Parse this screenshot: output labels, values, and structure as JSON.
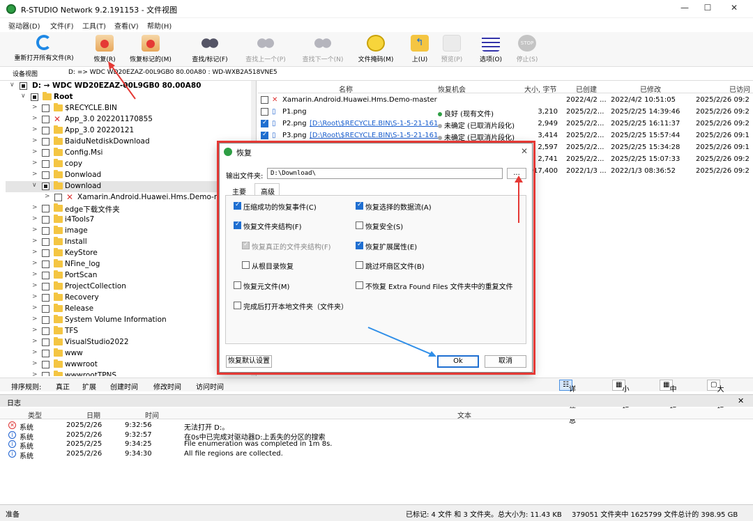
{
  "window": {
    "title": "R-STUDIO Network 9.2.191153 - 文件视图"
  },
  "menu": [
    "驱动器(D)",
    "文件(F)",
    "工具(T)",
    "查看(V)",
    "帮助(H)"
  ],
  "toolbar": [
    {
      "label": "重新打开所有文件(R)",
      "icon": "refresh-icon",
      "enabled": true
    },
    {
      "label": "恢复(R)",
      "icon": "recover-icon",
      "enabled": true
    },
    {
      "label": "恢复标记的(M)",
      "icon": "recover-marked-icon",
      "enabled": true
    },
    {
      "label": "查找/标记(F)",
      "icon": "binoculars-icon",
      "enabled": true
    },
    {
      "label": "查找上一个(P)",
      "icon": "find-prev-icon",
      "enabled": false
    },
    {
      "label": "查找下一个(N)",
      "icon": "find-next-icon",
      "enabled": false
    },
    {
      "label": "文件掩码(M)",
      "icon": "mask-icon",
      "enabled": true
    },
    {
      "label": "上(U)",
      "icon": "folder-up-icon",
      "enabled": true
    },
    {
      "label": "预览(P)",
      "icon": "preview-icon",
      "enabled": false
    },
    {
      "label": "选项(O)",
      "icon": "options-icon",
      "enabled": true
    },
    {
      "label": "停止(S)",
      "icon": "stop-icon",
      "enabled": false
    }
  ],
  "pathbar": {
    "tab": "设备视图",
    "path": "D: => WDC WD20EZAZ-00L9GB0 80.00A80 : WD-WXB2A518VNE5"
  },
  "tree": {
    "drive": "D: → WDC WD20EZAZ-00L9GB0 80.00A80",
    "root": "Root",
    "items": [
      {
        "label": "$RECYCLE.BIN",
        "x": false
      },
      {
        "label": "App_3.0 202201170855",
        "x": true
      },
      {
        "label": "App_3.0 20220121",
        "x": false
      },
      {
        "label": "BaiduNetdiskDownload",
        "x": false
      },
      {
        "label": "Config.Msi",
        "x": false
      },
      {
        "label": "copy",
        "x": false
      },
      {
        "label": "Donwload",
        "x": false
      },
      {
        "label": "Download",
        "x": false
      },
      {
        "label": "Xamarin.Android.Huawei.Hms.Demo-mas",
        "x": true
      },
      {
        "label": "edge下载文件夹",
        "x": false
      },
      {
        "label": "i4Tools7",
        "x": false
      },
      {
        "label": "image",
        "x": false
      },
      {
        "label": "Install",
        "x": false
      },
      {
        "label": "KeyStore",
        "x": false
      },
      {
        "label": "NFine_log",
        "x": false
      },
      {
        "label": "PortScan",
        "x": false
      },
      {
        "label": "ProjectCollection",
        "x": false
      },
      {
        "label": "Recovery",
        "x": false
      },
      {
        "label": "Release",
        "x": false
      },
      {
        "label": "System Volume Information",
        "x": false
      },
      {
        "label": "TFS",
        "x": false
      },
      {
        "label": "VisualStudio2022",
        "x": false
      },
      {
        "label": "www",
        "x": false
      },
      {
        "label": "wwwroot",
        "x": false
      },
      {
        "label": "wwwrootTPNS",
        "x": false
      }
    ]
  },
  "list": {
    "headers": [
      "名称",
      "恢复机会",
      "大小, 字节",
      "已创建",
      "已修改",
      "已访问"
    ],
    "rows": [
      {
        "name": "Xamarin.Android.Huawei.Hms.Demo-master",
        "link": "",
        "chance": "",
        "size": "",
        "created": "2022/4/2 ...",
        "modified": "2022/4/2 10:51:05",
        "accessed": "2025/2/26 09:2"
      },
      {
        "name": "P1.png",
        "link": "",
        "chance": "良好 (现有文件)",
        "size": "3,210",
        "created": "2025/2/2...",
        "modified": "2025/2/25 14:39:46",
        "accessed": "2025/2/26 09:2"
      },
      {
        "name": "P2.png",
        "link": "[D:\\Root\\$RECYCLE.BIN\\S-1-5-21-161",
        "chance": "未确定 (已取消片段化)",
        "size": "2,949",
        "created": "2025/2/2...",
        "modified": "2025/2/25 16:11:37",
        "accessed": "2025/2/26 09:2"
      },
      {
        "name": "P3.png",
        "link": "[D:\\Root\\$RECYCLE.BIN\\S-1-5-21-161",
        "chance": "未确定 (已取消片段化)",
        "size": "3,414",
        "created": "2025/2/2...",
        "modified": "2025/2/25 15:57:44",
        "accessed": "2025/2/26 09:1"
      },
      {
        "name": "",
        "link": "",
        "chance": "",
        "size": "2,597",
        "created": "2025/2/2...",
        "modified": "2025/2/25 15:34:28",
        "accessed": "2025/2/26 09:1"
      },
      {
        "name": "",
        "link": "",
        "chance": "",
        "size": "2,741",
        "created": "2025/2/2...",
        "modified": "2025/2/25 15:07:33",
        "accessed": "2025/2/26 09:2"
      },
      {
        "name": "",
        "link": "",
        "chance": "",
        "size": "917,400",
        "created": "2022/1/3 ...",
        "modified": "2022/1/3 08:36:52",
        "accessed": "2025/2/26 09:2"
      }
    ]
  },
  "sortbar": {
    "label": "排序规则:",
    "items": [
      "真正",
      "扩展",
      "创建时间",
      "修改时间",
      "访问时间"
    ],
    "views": [
      "详细信息",
      "小图标",
      "中图标",
      "大图标"
    ]
  },
  "log": {
    "title": "日志",
    "headers": [
      "类型",
      "日期",
      "时间",
      "文本"
    ],
    "rows": [
      {
        "type": "系统",
        "date": "2025/2/26",
        "time": "9:32:56",
        "text": "无法打开 D:。",
        "level": "error"
      },
      {
        "type": "系统",
        "date": "2025/2/26",
        "time": "9:32:57",
        "text": "在0s中已完成对驱动器D:上丢失的分区的搜索",
        "level": "info"
      },
      {
        "type": "系统",
        "date": "2025/2/25",
        "time": "9:34:25",
        "text": "File enumeration was completed in 1m 8s.",
        "level": "info"
      },
      {
        "type": "系统",
        "date": "2025/2/26",
        "time": "9:34:30",
        "text": "All file regions are collected.",
        "level": "info"
      }
    ]
  },
  "status": {
    "ready": "准备",
    "marked": "已标记: 4 文件 和 3 文件夹。总大小为: 11.43 KB",
    "total": "379051 文件夹中 1625799 文件总计的 398.95 GB"
  },
  "dialog": {
    "title": "恢复",
    "output_label": "输出文件夹:",
    "output_value": "D:\\Download\\",
    "browse": "...",
    "tabs": [
      "主要",
      "高级"
    ],
    "options_left": [
      {
        "label": "压缩成功的恢复事件(C)",
        "checked": true,
        "disabled": false
      },
      {
        "label": "恢复文件夹结构(F)",
        "checked": true,
        "disabled": false
      },
      {
        "label": "恢复真正的文件夹结构(F)",
        "checked": true,
        "disabled": true
      },
      {
        "label": "从根目录恢复",
        "checked": false,
        "disabled": false
      },
      {
        "label": "恢复元文件(M)",
        "checked": false,
        "disabled": false
      },
      {
        "label": "完成后打开本地文件夹（文件夹）",
        "checked": false,
        "disabled": false
      }
    ],
    "options_right": [
      {
        "label": "恢复选择的数据流(A)",
        "checked": true
      },
      {
        "label": "恢复安全(S)",
        "checked": false
      },
      {
        "label": "恢复扩展属性(E)",
        "checked": true
      },
      {
        "label": "跳过坏扇区文件(B)",
        "checked": false
      },
      {
        "label": "不恢复 Extra Found Files 文件夹中的重复文件",
        "checked": false
      }
    ],
    "defaults": "恢复默认设置",
    "ok": "Ok",
    "cancel": "取消"
  },
  "colors": {
    "accent": "#1f6fd1",
    "highlight": "#e53935",
    "arrow": "#2f8ee8"
  }
}
